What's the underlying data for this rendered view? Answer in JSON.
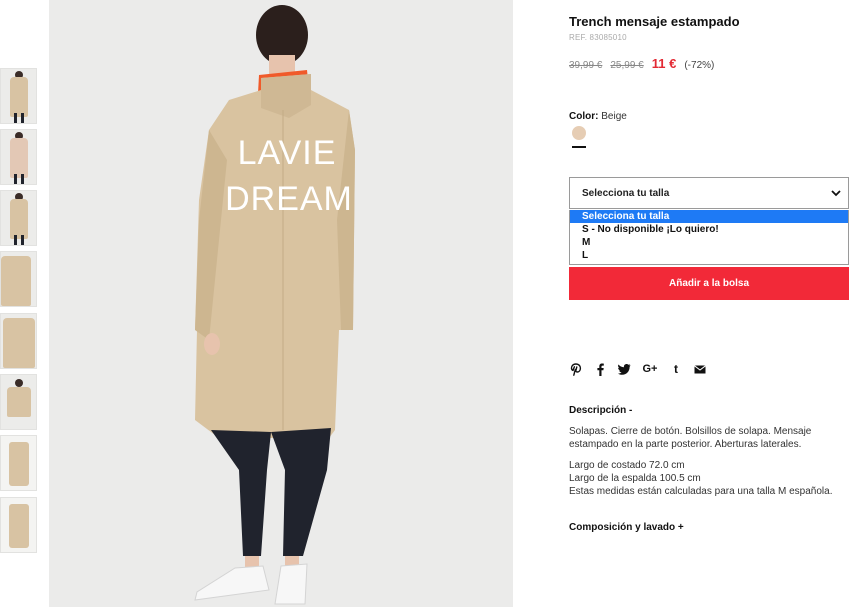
{
  "product": {
    "title": "Trench mensaje estampado",
    "ref": "REF. 83085010",
    "price_original": "39,99 €",
    "price_previous": "25,99 €",
    "price_current": "11 €",
    "discount": "(-72%)"
  },
  "color": {
    "label": "Color:",
    "value": "Beige",
    "swatch_hex": "#e6cdb4"
  },
  "size": {
    "select_label": "Selecciona tu talla",
    "options": [
      "Selecciona tu talla",
      "S - No disponible ¡Lo quiero!",
      "M",
      "L"
    ],
    "selected_index": 0
  },
  "actions": {
    "add_to_bag": "Añadir a la bolsa"
  },
  "share_icons": [
    "pinterest-icon",
    "facebook-icon",
    "twitter-icon",
    "google-plus-icon",
    "tumblr-icon",
    "email-icon"
  ],
  "description": {
    "title": "Descripción -",
    "text": "Solapas. Cierre de botón. Bolsillos de solapa. Mensaje estampado en la parte posterior. Aberturas laterales.",
    "measures": [
      "Largo de costado 72.0 cm",
      "Largo de la espalda 100.5 cm",
      "Estas medidas están calculadas para una talla M española."
    ]
  },
  "composition": {
    "title": "Composición y lavado +"
  },
  "image": {
    "back_print_line1": "LAVIE",
    "back_print_line2": "DREAM"
  },
  "colors": {
    "accent_red": "#f22938",
    "price_red": "#e32a34",
    "selected_option_blue": "#1e7af5"
  }
}
